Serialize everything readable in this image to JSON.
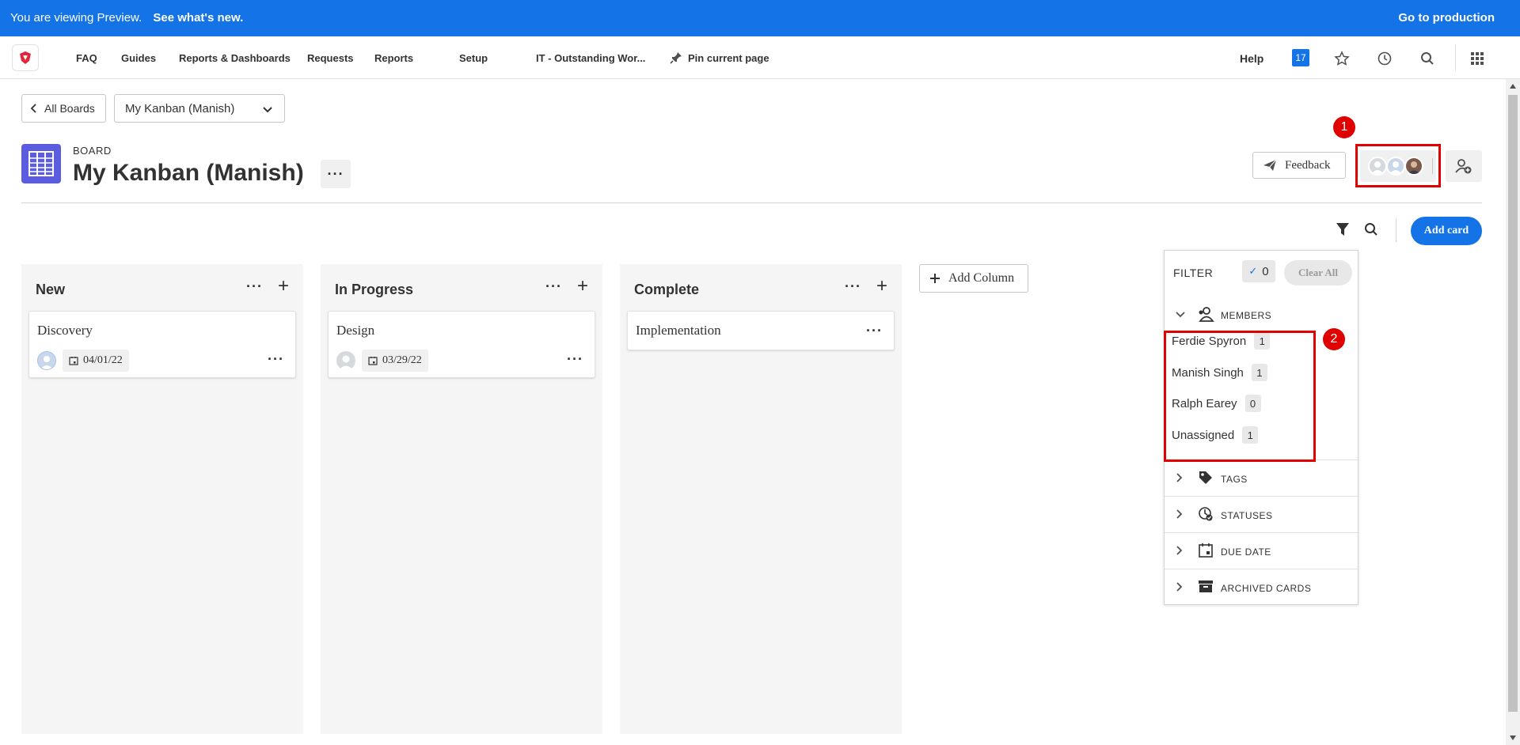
{
  "banner": {
    "message": "You are viewing Preview.",
    "link": "See what's new.",
    "go_production": "Go to production"
  },
  "nav": {
    "items": [
      "FAQ",
      "Guides",
      "Reports & Dashboards",
      "Requests",
      "Reports",
      "Setup",
      "IT - Outstanding Wor..."
    ],
    "pin": "Pin current page",
    "help": "Help",
    "notif_count": "17"
  },
  "breadcrumb": {
    "all_boards": "All Boards",
    "board_select": "My Kanban (Manish)"
  },
  "board": {
    "label": "BOARD",
    "title": "My Kanban (Manish)",
    "more": "···"
  },
  "actions": {
    "feedback": "Feedback",
    "add_card": "Add card",
    "add_column": "Add Column"
  },
  "markers": {
    "one": "1",
    "two": "2"
  },
  "columns": [
    {
      "name": "New",
      "card": {
        "title": "Discovery",
        "date": "04/01/22"
      }
    },
    {
      "name": "In Progress",
      "card": {
        "title": "Design",
        "date": "03/29/22"
      }
    },
    {
      "name": "Complete",
      "card": {
        "title": "Implementation"
      }
    }
  ],
  "filter": {
    "title": "FILTER",
    "count": "0",
    "clear_all": "Clear All",
    "members_label": "MEMBERS",
    "members": [
      {
        "name": "Ferdie Spyron",
        "count": "1"
      },
      {
        "name": "Manish Singh",
        "count": "1"
      },
      {
        "name": "Ralph Earey",
        "count": "0"
      },
      {
        "name": "Unassigned",
        "count": "1"
      }
    ],
    "sections": [
      "TAGS",
      "STATUSES",
      "DUE DATE",
      "ARCHIVED CARDS"
    ]
  },
  "colors": {
    "accent": "#1473e6",
    "highlight": "#e00000",
    "board_icon": "#5c5ce0"
  }
}
